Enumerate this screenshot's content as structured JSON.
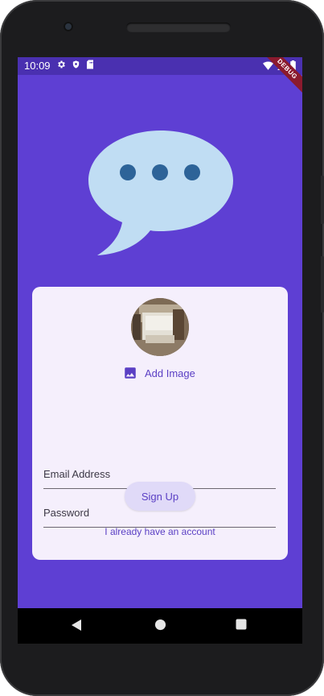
{
  "status_bar": {
    "time": "10:09",
    "left_icons": [
      "settings-icon",
      "shield-icon",
      "sim-card-icon"
    ],
    "right_icons": [
      "wifi-icon",
      "signal-icon",
      "battery-icon"
    ],
    "debug_label": "DEBUG"
  },
  "logo": {
    "icon": "chat-bubble-icon",
    "colors": {
      "bubble": "#c0ddf3",
      "dots": "#2d6398"
    }
  },
  "form": {
    "add_image_label": "Add Image",
    "email_placeholder": "Email Address",
    "password_placeholder": "Password",
    "signup_label": "Sign Up",
    "login_link": "I already have an account"
  },
  "nav_bar": {
    "buttons": [
      "back-icon",
      "home-icon",
      "recents-icon"
    ]
  },
  "colors": {
    "background": "#5e3fd3",
    "status_bar": "#4a30b0",
    "card": "#f5effc",
    "accent": "#5a3fc4",
    "button_bg": "#e0daf8"
  }
}
